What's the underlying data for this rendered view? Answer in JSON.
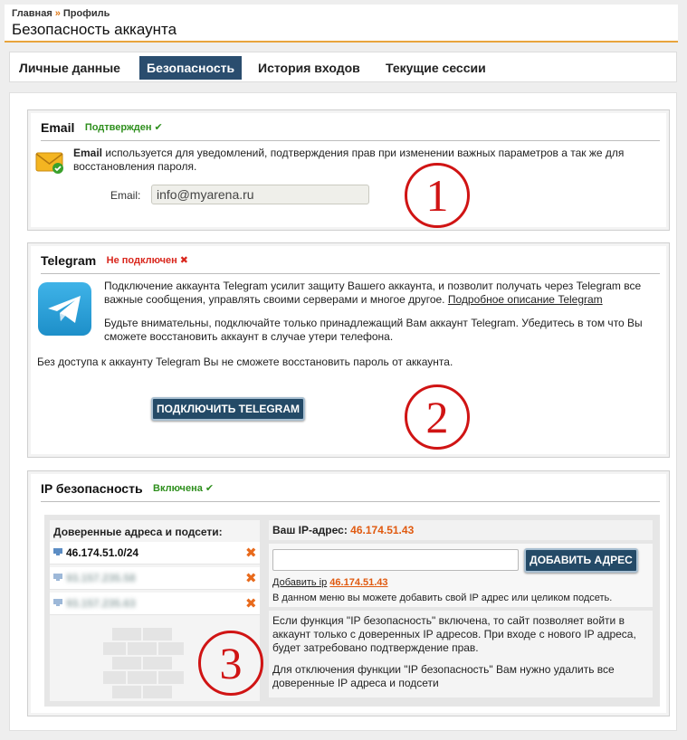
{
  "breadcrumb": {
    "home": "Главная",
    "separator": "»",
    "current": "Профиль"
  },
  "page": {
    "title": "Безопасность аккаунта"
  },
  "tabs": [
    {
      "label": "Личные данные",
      "active": false
    },
    {
      "label": "Безопасность",
      "active": true
    },
    {
      "label": "История входов",
      "active": false
    },
    {
      "label": "Текущие сессии",
      "active": false
    }
  ],
  "email": {
    "title": "Email",
    "status": "Подтвержден",
    "status_mark": "✔",
    "desc_bold": "Email",
    "desc": "используется для уведомлений, подтверждения прав при изменении важных параметров а так же для восстановления пароля.",
    "field_label": "Email:",
    "field_value": "info@myarena.ru",
    "marker": "1"
  },
  "telegram": {
    "title": "Telegram",
    "status": "Не подключен",
    "status_mark": "✖",
    "desc1": "Подключение аккаунта Telegram усилит защиту Вашего аккаунта, и позволит получать через Telegram все важные сообщения, управлять своими серверами и многое другое.",
    "desc1_link": "Подробное описание Telegram",
    "desc2": "Будьте внимательны, подключайте только принадлежащий Вам аккаунт Telegram. Убедитесь в том что Вы сможете восстановить аккаунт в случае утери телефона.",
    "desc3": "Без доступа к аккаунту Telegram Вы не сможете восстановить пароль от аккаунта.",
    "button": "ПОДКЛЮЧИТЬ TELEGRAM",
    "marker": "2"
  },
  "ip": {
    "title": "IP безопасность",
    "status": "Включена",
    "status_mark": "✔",
    "trusted_title": "Доверенные адреса и подсети:",
    "trusted": [
      {
        "value": "46.174.51.0/24",
        "hidden": false
      },
      {
        "value": "93.157.235.58",
        "hidden": true
      },
      {
        "value": "93.157.235.63",
        "hidden": true
      }
    ],
    "delete_glyph": "✖",
    "your_ip_label": "Ваш IP-адрес:",
    "your_ip": "46.174.51.43",
    "add_button": "ДОБАВИТЬ АДРЕС",
    "add_ip_link_prefix": "Добавить ip",
    "add_ip_link_value": "46.174.51.43",
    "add_hint": "В данном меню вы можете добавить свой IP адрес или целиком подсеть.",
    "info1": "Если функция \"IP безопасность\" включена, то сайт позволяет войти в аккаунт только с доверенных IP адресов. При входе с нового IP адреса, будет затребовано подтверждение прав.",
    "info2": "Для отключения функции \"IP безопасность\" Вам нужно удалить все доверенные IP адреса и подсети",
    "marker": "3"
  },
  "colors": {
    "accent": "#e8a43c",
    "tab_active": "#2a4d6e",
    "button": "#244a67",
    "ok": "#2e8f1d",
    "bad": "#d9261c",
    "marker": "#d01414",
    "ip_orange": "#e05a10"
  }
}
